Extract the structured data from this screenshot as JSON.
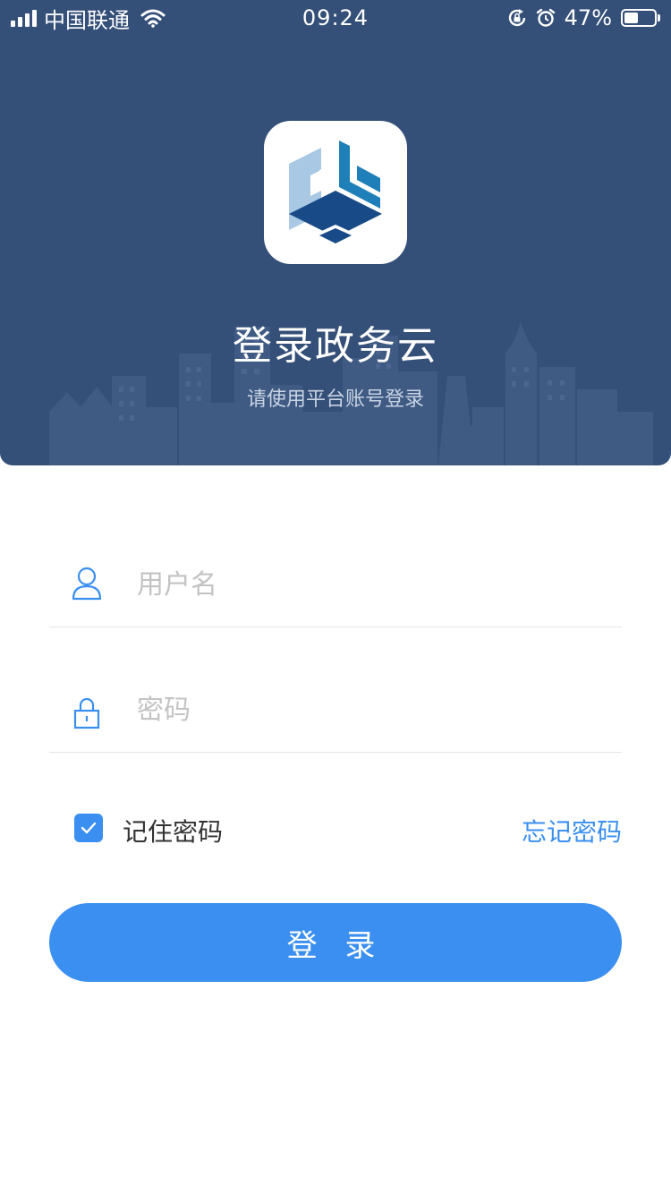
{
  "status_bar": {
    "carrier": "中国联通",
    "time": "09:24",
    "battery_percent_text": "47%",
    "battery_level": 0.47,
    "icons": [
      "signal-icon",
      "wifi-icon",
      "rotation-lock-icon",
      "alarm-icon",
      "battery-icon"
    ]
  },
  "header": {
    "app_logo": "app-logo-cube-icon",
    "title": "登录政务云",
    "subtitle": "请使用平台账号登录",
    "background_color": "#344f78"
  },
  "form": {
    "username": {
      "icon": "user-icon",
      "placeholder": "用户名",
      "value": ""
    },
    "password": {
      "icon": "lock-icon",
      "placeholder": "密码",
      "value": ""
    },
    "remember": {
      "checked": true,
      "label": "记住密码"
    },
    "forgot_label": "忘记密码",
    "login_label": "登 录"
  },
  "colors": {
    "accent": "#3a8ff0",
    "header": "#344f78",
    "placeholder": "#c3c3c3",
    "divider": "#e6e6e6"
  }
}
